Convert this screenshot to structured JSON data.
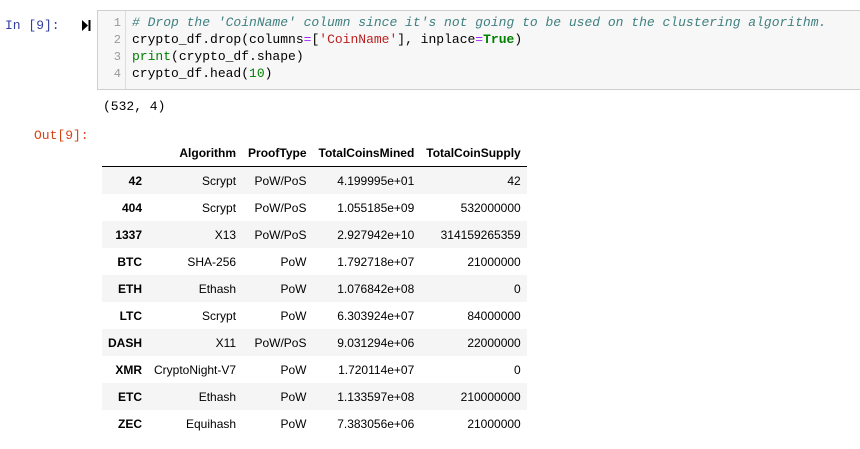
{
  "input_prompt": "In [9]:",
  "output_prompt": "Out[9]:",
  "code_lines": [
    {
      "num": "1",
      "segments": [
        {
          "t": "# Drop the 'CoinName' column since it's not going to be used on the clustering algorithm.",
          "c": "comment"
        }
      ]
    },
    {
      "num": "2",
      "segments": [
        {
          "t": "crypto_df.drop(columns",
          "c": ""
        },
        {
          "t": "=",
          "c": "op"
        },
        {
          "t": "[",
          "c": ""
        },
        {
          "t": "'CoinName'",
          "c": "str"
        },
        {
          "t": "], inplace",
          "c": ""
        },
        {
          "t": "=",
          "c": "op"
        },
        {
          "t": "True",
          "c": "kw"
        },
        {
          "t": ")",
          "c": ""
        }
      ]
    },
    {
      "num": "3",
      "segments": [
        {
          "t": "print",
          "c": "builtin"
        },
        {
          "t": "(crypto_df.shape)",
          "c": ""
        }
      ]
    },
    {
      "num": "4",
      "segments": [
        {
          "t": "crypto_df.head(",
          "c": ""
        },
        {
          "t": "10",
          "c": "builtin"
        },
        {
          "t": ")",
          "c": ""
        }
      ]
    }
  ],
  "stdout": "(532, 4)",
  "table": {
    "columns": [
      "Algorithm",
      "ProofType",
      "TotalCoinsMined",
      "TotalCoinSupply"
    ],
    "rows": [
      {
        "index": "42",
        "cells": [
          "Scrypt",
          "PoW/PoS",
          "4.199995e+01",
          "42"
        ]
      },
      {
        "index": "404",
        "cells": [
          "Scrypt",
          "PoW/PoS",
          "1.055185e+09",
          "532000000"
        ]
      },
      {
        "index": "1337",
        "cells": [
          "X13",
          "PoW/PoS",
          "2.927942e+10",
          "314159265359"
        ]
      },
      {
        "index": "BTC",
        "cells": [
          "SHA-256",
          "PoW",
          "1.792718e+07",
          "21000000"
        ]
      },
      {
        "index": "ETH",
        "cells": [
          "Ethash",
          "PoW",
          "1.076842e+08",
          "0"
        ]
      },
      {
        "index": "LTC",
        "cells": [
          "Scrypt",
          "PoW",
          "6.303924e+07",
          "84000000"
        ]
      },
      {
        "index": "DASH",
        "cells": [
          "X11",
          "PoW/PoS",
          "9.031294e+06",
          "22000000"
        ]
      },
      {
        "index": "XMR",
        "cells": [
          "CryptoNight-V7",
          "PoW",
          "1.720114e+07",
          "0"
        ]
      },
      {
        "index": "ETC",
        "cells": [
          "Ethash",
          "PoW",
          "1.133597e+08",
          "210000000"
        ]
      },
      {
        "index": "ZEC",
        "cells": [
          "Equihash",
          "PoW",
          "7.383056e+06",
          "21000000"
        ]
      }
    ]
  },
  "icons": {
    "run": "run-cell-icon"
  },
  "colors": {
    "input_prompt": "#303f9f",
    "output_prompt": "#d84315",
    "comment": "#408080",
    "string": "#ba2121",
    "keyword": "#008000",
    "operator": "#aa22ff"
  }
}
